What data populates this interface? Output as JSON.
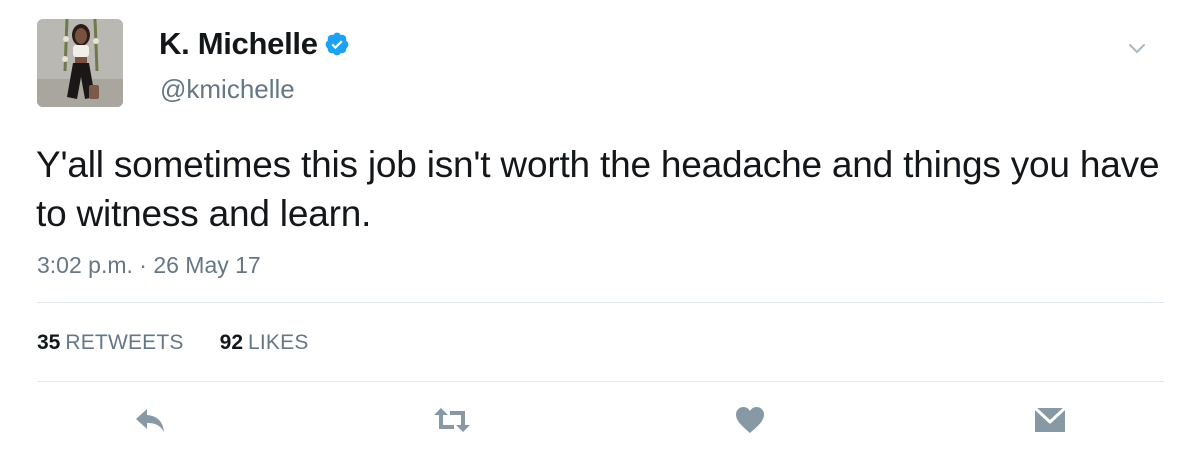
{
  "author": {
    "display_name": "K. Michelle",
    "handle": "@kmichelle",
    "verified": true,
    "verified_color": "#1da1f2"
  },
  "tweet": {
    "text": "Y'all sometimes this job isn't worth the headache and things you have to witness and learn.",
    "timestamp": "3:02 p.m. · 26 May 17"
  },
  "stats": {
    "retweets_count": "35",
    "retweets_label": "RETWEETS",
    "likes_count": "92",
    "likes_label": "LIKES"
  },
  "actions": [
    {
      "name": "reply",
      "icon": "reply-icon"
    },
    {
      "name": "retweet",
      "icon": "retweet-icon"
    },
    {
      "name": "like",
      "icon": "heart-icon"
    },
    {
      "name": "direct-message",
      "icon": "envelope-icon"
    }
  ],
  "colors": {
    "text_primary": "#14171a",
    "text_secondary": "#657786",
    "icon_gray": "#8899a6",
    "divider": "#e1e8ed"
  }
}
